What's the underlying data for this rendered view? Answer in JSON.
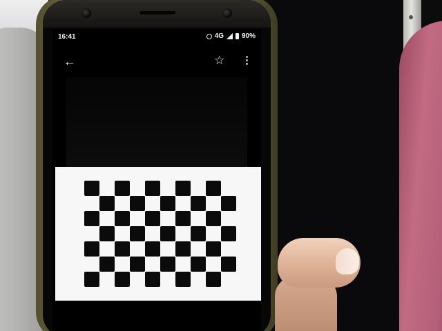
{
  "status_bar": {
    "time": "16:41",
    "network": "4G",
    "battery": "90%"
  },
  "app_bar": {
    "back_icon": "back-arrow-icon",
    "favorite_icon": "star-icon",
    "more_icon": "more-vertical-icon"
  },
  "displayed_image": {
    "pattern": "checkerboard",
    "rows": 7,
    "columns": 10,
    "colors": {
      "dark": "#0b0b0b",
      "light": "#f7f7f7"
    }
  },
  "colors": {
    "phone_case": "#6a6643",
    "towel": "#c26b82",
    "sweater": "#b2b2b0"
  }
}
